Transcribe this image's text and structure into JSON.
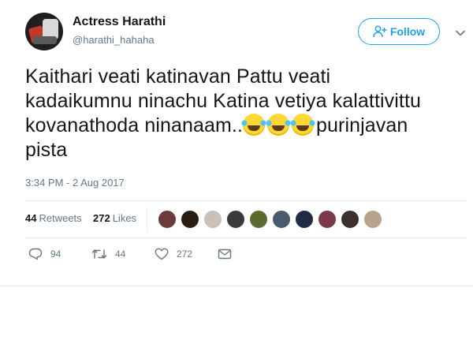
{
  "user": {
    "display_name": "Actress Harathi",
    "handle": "@harathi_hahaha"
  },
  "follow": {
    "label": "Follow"
  },
  "tweet": {
    "line1": "Kaithari veati katinavan Pattu veati",
    "line2": "kadaikumnu ninachu Katina vetiya kalattivittu",
    "line3_text": "kovanathoda ninanaam..",
    "emoji_names": [
      "face-with-tears-of-joy",
      "face-with-tears-of-joy",
      "face-with-tears-of-joy"
    ],
    "line3_tail": "purinjavan",
    "line4": "pista",
    "timestamp": "3:34 PM - 2 Aug 2017"
  },
  "stats": {
    "retweets_count": "44",
    "retweets_label": "Retweets",
    "likes_count": "272",
    "likes_label": "Likes",
    "liker_colors": [
      "#6b3b3b",
      "#2b1d12",
      "#c9c0b8",
      "#3a3a3a",
      "#5a6b2e",
      "#4a5a6e",
      "#1f2a44",
      "#7a3a4a",
      "#3b2f2f",
      "#b8a48a"
    ]
  },
  "actions": {
    "reply_count": "94",
    "retweet_count": "44",
    "like_count": "272"
  },
  "colors": {
    "accent": "#1da1f2",
    "muted": "#657786",
    "text": "#14171a",
    "border": "#e6ecf0"
  }
}
